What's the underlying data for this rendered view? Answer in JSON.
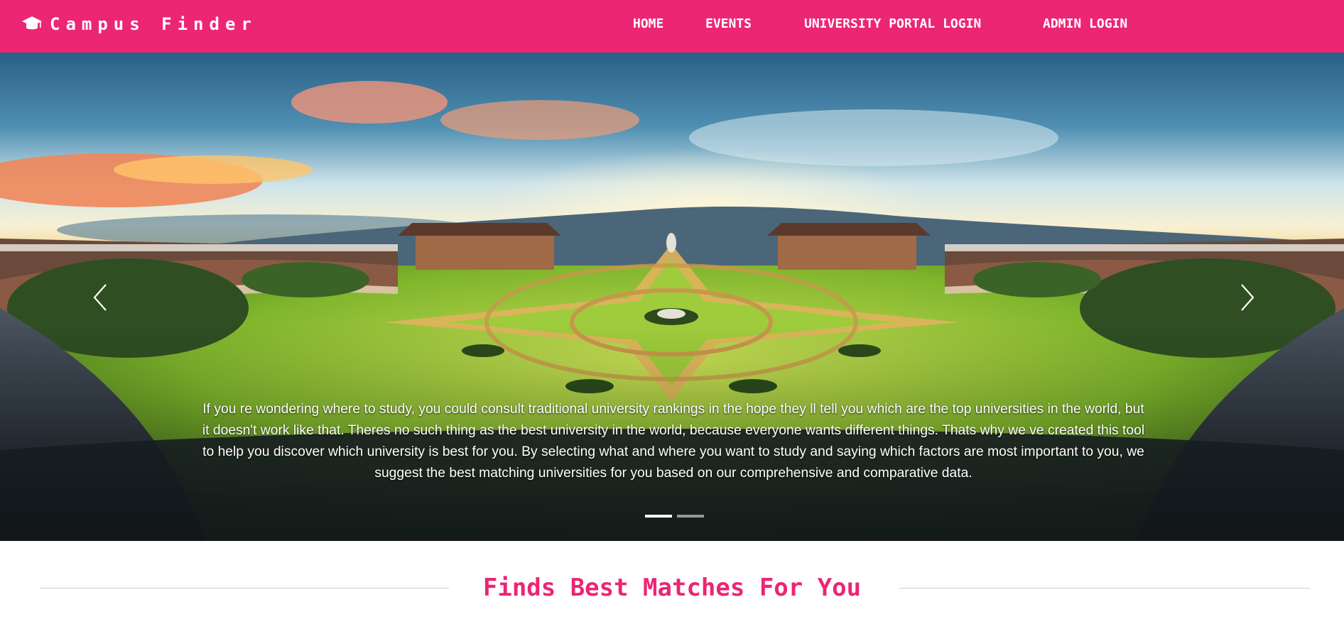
{
  "brand": {
    "name": "Campus Finder",
    "icon": "graduation-cap-icon"
  },
  "nav": {
    "home": "HOME",
    "events": "EVENTS",
    "portal_login": "UNIVERSITY PORTAL LOGIN",
    "admin_login": "ADMIN LOGIN"
  },
  "carousel": {
    "caption": "If you re wondering where to study, you could consult traditional university rankings in the hope they ll tell you which are the top universities in the world, but it doesn't work like that. Theres no such thing as the best university in the world, because everyone wants different things. Thats why we ve created this tool to help you discover which university is best for you. By selecting what and where you want to study and saying which factors are most important to you, we suggest the best matching universities for you based on our comprehensive and comparative data.",
    "slide_count": 2,
    "active_slide": 1,
    "prev_icon": "chevron-left-icon",
    "next_icon": "chevron-right-icon"
  },
  "section": {
    "title": "Finds Best Matches For You"
  },
  "colors": {
    "brand_pink": "#ec2574",
    "nav_text": "#ffffff",
    "divider": "#cfcfcf"
  }
}
